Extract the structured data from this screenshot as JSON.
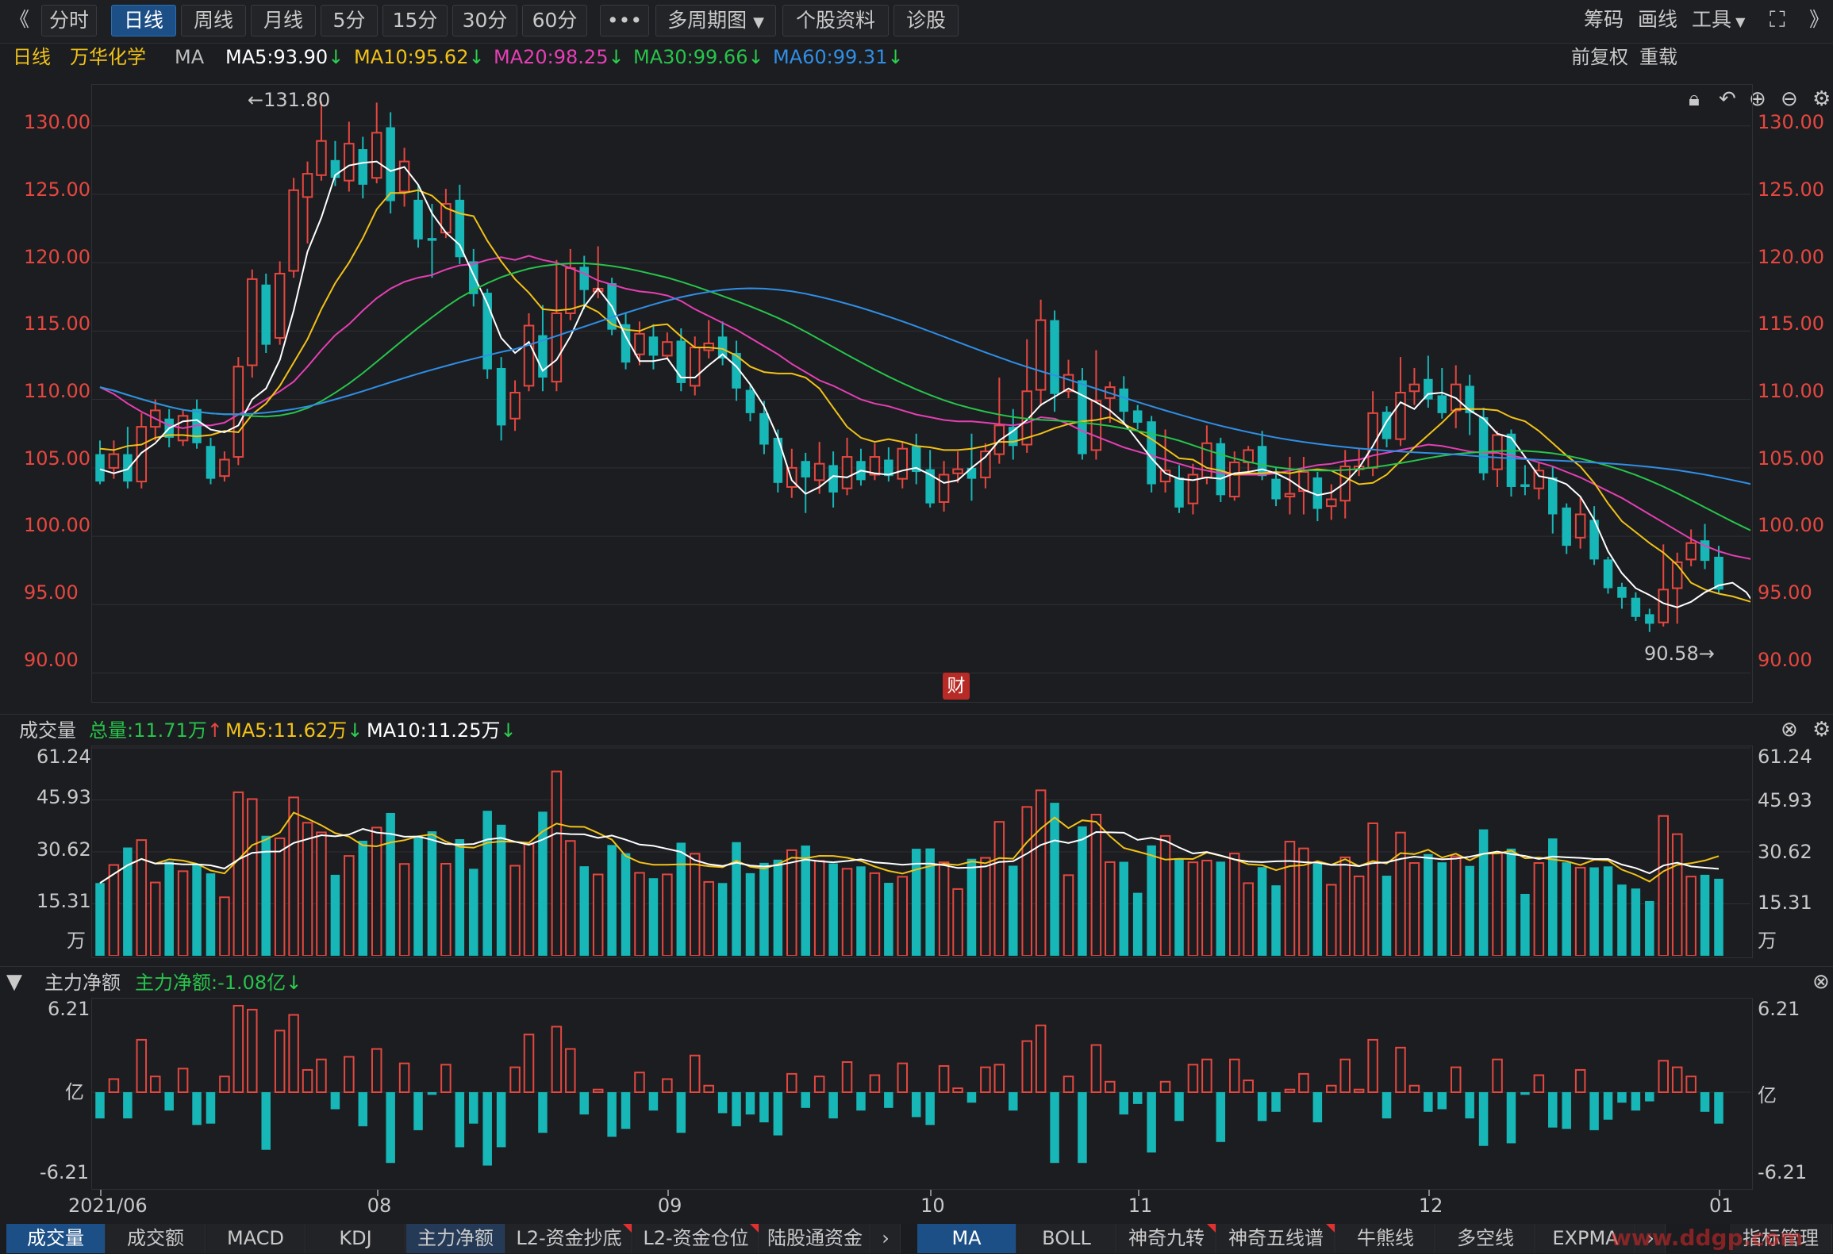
{
  "toolbar": {
    "collapse_icon": "double-chevron-left-icon",
    "tabs": [
      "分时",
      "日线",
      "周线",
      "月线",
      "5分",
      "15分",
      "30分",
      "60分"
    ],
    "active_tab": "日线",
    "more": "•••",
    "multi_period": "多周期图",
    "stock_info": "个股资料",
    "diagnose": "诊股",
    "right": {
      "chips": "筹码",
      "draw": "画线",
      "tools": "工具",
      "fullscreen_icon": "fullscreen-icon",
      "expand_icon": "double-chevron-right-icon"
    }
  },
  "infobar": {
    "period": "日线",
    "stock_name": "万华化学",
    "ma_label": "MA",
    "ma5": "MA5:93.90",
    "ma10": "MA10:95.62",
    "ma20": "MA20:98.25",
    "ma30": "MA30:99.66",
    "ma60": "MA60:99.31",
    "adjust": "前复权",
    "overlay": "重载"
  },
  "colors": {
    "up": "#e5473f",
    "down": "#17b6b7",
    "ma5": "#ffffff",
    "ma10": "#f2c217",
    "ma20": "#e53fb4",
    "ma30": "#27c44a",
    "ma60": "#2f8fe6",
    "grid": "#2f3034",
    "bg": "#1c1d21"
  },
  "price_panel": {
    "ticks": [
      "130.00",
      "125.00",
      "120.00",
      "115.00",
      "110.00",
      "105.00",
      "100.00",
      "95.00",
      "90.00"
    ],
    "tick_values": [
      130,
      125,
      120,
      115,
      110,
      105,
      100,
      95,
      90
    ],
    "ylim": [
      88,
      133
    ],
    "high_label": "←131.80",
    "low_label": "90.58→",
    "event_badge": "财"
  },
  "volume_panel": {
    "title": "成交量",
    "total": "总量:11.71万",
    "ma5": "MA5:11.62万",
    "ma10": "MA10:11.25万",
    "ticks": [
      "61.24",
      "45.93",
      "30.62",
      "15.31"
    ],
    "tick_values": [
      61.24,
      45.93,
      30.62,
      15.31
    ],
    "unit": "万"
  },
  "flow_panel": {
    "title": "主力净额",
    "value": "主力净额:-1.08亿",
    "top": "6.21",
    "bottom": "-6.21",
    "unit": "亿"
  },
  "x_axis": {
    "labels": [
      "2021/06",
      "08",
      "09",
      "10",
      "11",
      "12",
      "01"
    ],
    "label_index": [
      0,
      20,
      41,
      60,
      75,
      96,
      117
    ]
  },
  "bottom_tabs_left": [
    "成交量",
    "成交额",
    "MACD",
    "KDJ",
    "主力净额",
    "L2-资金抄底",
    "L2-资金仓位",
    "陆股通资金"
  ],
  "bottom_tabs_right": [
    "MA",
    "BOLL",
    "神奇九转",
    "神奇五线谱",
    "牛熊线",
    "多空线",
    "EXPMA"
  ],
  "bottom_right_label": "指标管理",
  "watermark": "www.ddgp.com",
  "chart_data": {
    "type": "candlestick",
    "candles": [
      [
        106,
        104,
        107,
        103.8
      ],
      [
        105,
        106,
        107,
        104.2
      ],
      [
        106,
        104,
        108,
        103.5
      ],
      [
        104,
        108,
        109,
        103.5
      ],
      [
        108,
        109.2,
        110,
        107
      ],
      [
        108.6,
        107.2,
        109.3,
        106.5
      ],
      [
        107,
        108.8,
        109.2,
        106.6
      ],
      [
        109.3,
        106.8,
        110,
        106.4
      ],
      [
        106.6,
        104.2,
        107.2,
        103.8
      ],
      [
        104.4,
        105.6,
        106.2,
        104
      ],
      [
        105.8,
        112.4,
        113.1,
        105.2
      ],
      [
        112.5,
        118.8,
        119.5,
        111.6
      ],
      [
        118.4,
        114,
        119.2,
        113.4
      ],
      [
        114.5,
        119.2,
        120.1,
        114
      ],
      [
        119.4,
        125.3,
        126.2,
        118.9
      ],
      [
        124.8,
        126.5,
        127.4,
        121.4
      ],
      [
        126.4,
        128.9,
        131.8,
        126
      ],
      [
        127.5,
        126.2,
        128.9,
        125.6
      ],
      [
        126,
        128.7,
        130.3,
        125.2
      ],
      [
        128.3,
        125.7,
        129.2,
        124.7
      ],
      [
        126.2,
        129.5,
        131.7,
        125.8
      ],
      [
        129.9,
        124.5,
        131,
        123.6
      ],
      [
        125.2,
        127.4,
        128.4,
        124.1
      ],
      [
        124.6,
        121.7,
        125.7,
        121.1
      ],
      [
        121.8,
        121.6,
        124.3,
        118.9
      ],
      [
        122.2,
        124.3,
        125.4,
        121.8
      ],
      [
        124.6,
        120.4,
        125.7,
        119.9
      ],
      [
        120.1,
        117.7,
        121,
        116.8
      ],
      [
        117.8,
        112.2,
        118.1,
        111.5
      ],
      [
        112.3,
        108.1,
        113.1,
        107
      ],
      [
        108.6,
        110.5,
        111.4,
        107.7
      ],
      [
        111,
        115.4,
        116.3,
        110.6
      ],
      [
        114.7,
        111.6,
        116.9,
        110.6
      ],
      [
        111.3,
        116.3,
        120.2,
        110.6
      ],
      [
        116.3,
        119.6,
        121,
        115.8
      ],
      [
        119.7,
        118,
        120.5,
        116.6
      ],
      [
        117.9,
        118.1,
        121.2,
        117.4
      ],
      [
        118.5,
        115.1,
        118.9,
        114.7
      ],
      [
        115.5,
        112.7,
        116.3,
        112.2
      ],
      [
        113.3,
        114.8,
        115.7,
        112.5
      ],
      [
        114.6,
        113.2,
        115.5,
        112.2
      ],
      [
        113.2,
        114.2,
        114.9,
        113
      ],
      [
        114.3,
        111.2,
        115.2,
        110.6
      ],
      [
        111,
        113.8,
        114.6,
        110.3
      ],
      [
        113.6,
        114.1,
        115.8,
        113
      ],
      [
        114.6,
        113,
        115.7,
        112.5
      ],
      [
        113.4,
        110.8,
        114.3,
        109.9
      ],
      [
        110.7,
        109,
        111.1,
        108.4
      ],
      [
        109,
        106.7,
        109.9,
        106
      ],
      [
        107.2,
        103.9,
        107.8,
        103.2
      ],
      [
        103.6,
        105,
        106.4,
        102.8
      ],
      [
        105.5,
        104.3,
        106.1,
        101.7
      ],
      [
        104.1,
        105.3,
        106.9,
        103.1
      ],
      [
        105.2,
        103.2,
        106.2,
        102.1
      ],
      [
        103.5,
        105.8,
        107.2,
        103
      ],
      [
        105.5,
        104.1,
        106.4,
        103.7
      ],
      [
        104.5,
        105.8,
        106.8,
        104.1
      ],
      [
        105.6,
        104.4,
        106.5,
        104
      ],
      [
        104.2,
        106.4,
        106.9,
        103.5
      ],
      [
        106.6,
        104.7,
        107.5,
        103.8
      ],
      [
        104.9,
        102.4,
        106.3,
        102.1
      ],
      [
        102.5,
        104.5,
        105.5,
        101.8
      ],
      [
        104.6,
        104.9,
        106.2,
        103.9
      ],
      [
        105,
        104.2,
        107.5,
        102.6
      ],
      [
        104.3,
        106.2,
        106.8,
        103.5
      ],
      [
        106,
        108.1,
        111.6,
        105.3
      ],
      [
        108,
        106.6,
        109.3,
        105.6
      ],
      [
        106.7,
        110.6,
        114.4,
        106.1
      ],
      [
        110.7,
        115.8,
        117.3,
        109.5
      ],
      [
        115.8,
        110.4,
        116.5,
        109.1
      ],
      [
        110.6,
        111.8,
        112.9,
        110.1
      ],
      [
        111.4,
        106,
        112.3,
        105.6
      ],
      [
        106.3,
        109.9,
        113.6,
        105.6
      ],
      [
        110.1,
        110.9,
        111.3,
        108.3
      ],
      [
        110.8,
        109.1,
        111.7,
        108.2
      ],
      [
        109.2,
        108.3,
        109.6,
        107.8
      ],
      [
        108.4,
        103.8,
        108.8,
        103.2
      ],
      [
        104,
        104.8,
        107.8,
        103.2
      ],
      [
        104.3,
        102.1,
        105.2,
        101.7
      ],
      [
        102.4,
        104.5,
        105.3,
        101.6
      ],
      [
        104.3,
        106.8,
        108.1,
        103.8
      ],
      [
        106.8,
        103,
        107.2,
        102.5
      ],
      [
        102.9,
        105.4,
        106.2,
        102.6
      ],
      [
        105.4,
        106.3,
        106.6,
        104.6
      ],
      [
        106.6,
        104.4,
        107.7,
        104.1
      ],
      [
        104.2,
        102.7,
        105,
        102.2
      ],
      [
        102.9,
        103.1,
        105.8,
        101.6
      ],
      [
        103.3,
        104.7,
        105.8,
        101.6
      ],
      [
        104.3,
        102,
        104.7,
        101.1
      ],
      [
        102.2,
        102.7,
        103.8,
        101.2
      ],
      [
        102.6,
        105.1,
        106.3,
        101.3
      ],
      [
        104.9,
        105.1,
        106.4,
        104.4
      ],
      [
        105,
        109,
        110.6,
        104.4
      ],
      [
        109.1,
        107.1,
        109.5,
        106.5
      ],
      [
        107.1,
        110.5,
        113.1,
        106.6
      ],
      [
        110.6,
        111.1,
        112.3,
        109.6
      ],
      [
        111.5,
        110,
        113.2,
        109.4
      ],
      [
        110.3,
        109,
        112.3,
        108.6
      ],
      [
        109.2,
        111.1,
        112.5,
        107.9
      ],
      [
        111,
        109,
        111.8,
        107.4
      ],
      [
        108.7,
        104.6,
        109.4,
        104.1
      ],
      [
        104.9,
        107.4,
        107.7,
        103.6
      ],
      [
        107.5,
        103.6,
        107.8,
        102.9
      ],
      [
        103.8,
        103.6,
        105.2,
        103
      ],
      [
        103.5,
        104.8,
        105.4,
        102.7
      ],
      [
        104.3,
        101.6,
        105.1,
        100.2
      ],
      [
        102.1,
        99.3,
        102.4,
        98.7
      ],
      [
        99.9,
        101.6,
        102.9,
        99.1
      ],
      [
        101.2,
        98.3,
        102.2,
        97.9
      ],
      [
        98.3,
        96.2,
        98.5,
        95.8
      ],
      [
        96.3,
        95.5,
        96.6,
        94.7
      ],
      [
        95.5,
        94.1,
        95.9,
        93.8
      ],
      [
        94.3,
        93.6,
        94.7,
        93
      ],
      [
        93.7,
        96.1,
        99.4,
        93.4
      ],
      [
        96.2,
        98.1,
        98.8,
        93.6
      ],
      [
        98.3,
        99.5,
        100.5,
        97.8
      ],
      [
        99.7,
        98.2,
        100.9,
        97.6
      ],
      [
        98.5,
        96.1,
        99.3,
        95.8
      ]
    ],
    "ma5": [
      104.9,
      104.6,
      104.9,
      106.1,
      106.8,
      107.9,
      108.4,
      108.5,
      107.8,
      107.6,
      108.1,
      110,
      110.8,
      112.9,
      116.5,
      120.8,
      123.3,
      126.4,
      127.1,
      127.3,
      127.4,
      126.7,
      127,
      125.7,
      123.6,
      122.2,
      121.3,
      119.1,
      117,
      114.5,
      113.4,
      114.2,
      112.1,
      112.9,
      114.6,
      116.8,
      118.1,
      116.8,
      114.6,
      112.8,
      112.8,
      113,
      111.6,
      111.6,
      112.5,
      113.3,
      112.4,
      111.1,
      109.5,
      107.2,
      104.1,
      103.1,
      103.6,
      104.4,
      104.3,
      104.8,
      104.6,
      104.5,
      104.8,
      105,
      104.5,
      103.9,
      104.1,
      105,
      105.8,
      107,
      107.7,
      108.5,
      109.6,
      110.2,
      110.8,
      110.3,
      109.8,
      109.2,
      108.3,
      107,
      105.7,
      104.6,
      104.2,
      104.1,
      104.3,
      104.2,
      104.6,
      104.7,
      104.9,
      104.6,
      104.1,
      103.4,
      103,
      103.2,
      103.9,
      105,
      106.6,
      108.4,
      109.8,
      109.3,
      110.4,
      110.5,
      110.1,
      109.2,
      108.6,
      107.5,
      107.2,
      105.8,
      104.4,
      104.2,
      103.8,
      102.9,
      101.2,
      98.9,
      97.3,
      96.2,
      95.7,
      95.1,
      94.8,
      95.2,
      95.9,
      96.4,
      96.6,
      95.9,
      94.4,
      93.9
    ],
    "ma10": [
      106.4,
      106.3,
      106.6,
      106.7,
      107.2,
      107.4,
      107.4,
      107.3,
      107.4,
      107.7,
      107.6,
      108.9,
      109.7,
      111,
      112.7,
      114.4,
      116.6,
      118.5,
      120,
      121.8,
      123.9,
      125.1,
      125.1,
      125.3,
      124.9,
      124,
      123.6,
      123.4,
      121.6,
      120.1,
      118.8,
      117.8,
      116.6,
      116.5,
      116.6,
      116.9,
      116.4,
      115.5,
      115.1,
      115,
      115.4,
      115.5,
      114.6,
      113.8,
      113.8,
      113.7,
      113.2,
      112.4,
      112,
      111.9,
      111.9,
      111.6,
      110.8,
      109.4,
      108,
      107.2,
      106.9,
      107.1,
      106.9,
      106.6,
      106.5,
      106.3,
      106.3,
      106.4,
      106.6,
      106.9,
      106.9,
      107.2,
      107.5,
      107.9,
      108.2,
      108.4,
      108.5,
      108.7,
      108.2,
      107.7,
      107.1,
      106.4,
      105.7,
      105.6,
      105,
      104.8,
      104.5,
      104.6,
      104.6,
      104.7,
      104.6,
      104.8,
      104.9,
      104.8,
      104.3,
      103.8,
      103.9,
      104.5,
      105.5,
      106.5,
      107.4,
      108.3,
      109.3,
      109.3,
      109.3,
      109.2,
      108.7,
      108.4,
      107.7,
      106.8,
      105.9,
      105.1,
      103.9,
      102.4,
      101.1,
      100.3,
      99.5,
      98.8,
      97.9,
      96.6,
      96.1,
      95.8,
      95.6,
      95.3,
      95
    ],
    "ma20": [
      110.9,
      110.4,
      109.7,
      109.1,
      108.6,
      108.1,
      107.9,
      108.1,
      108.1,
      108.3,
      108.9,
      109.4,
      110,
      110.6,
      111.3,
      112.4,
      113.6,
      114.7,
      115.5,
      116.5,
      117.4,
      118.1,
      118.6,
      118.9,
      119.1,
      119.5,
      119.8,
      119.9,
      120.2,
      120.4,
      120.2,
      120.5,
      120.2,
      120,
      119.6,
      119.2,
      118.7,
      118.4,
      118.1,
      117.9,
      117.8,
      117.6,
      117.2,
      116.6,
      116.1,
      115.6,
      115.1,
      114.5,
      113.9,
      113.3,
      112.6,
      112,
      111.4,
      111,
      110.5,
      110,
      109.7,
      109.5,
      109.2,
      108.9,
      108.7,
      108.5,
      108.4,
      108.4,
      108.3,
      108.2,
      108.1,
      108.3,
      108.7,
      108.6,
      108.2,
      107.7,
      107.3,
      106.9,
      106.5,
      106.2,
      105.9,
      105.6,
      105.3,
      105,
      104.8,
      104.6,
      104.5,
      104.5,
      104.5,
      104.6,
      104.8,
      105,
      105.2,
      105.3,
      105.5,
      105.6,
      105.9,
      106.1,
      106.3,
      106.5,
      106.7,
      106.6,
      106.4,
      106.2,
      106.1,
      106.1,
      105.9,
      105.7,
      105.4,
      105.1,
      104.7,
      104.3,
      103.8,
      103.3,
      102.8,
      102.2,
      101.6,
      101,
      100.4,
      99.8,
      99.3,
      98.9,
      98.6,
      98.4,
      98.2
    ]
  }
}
